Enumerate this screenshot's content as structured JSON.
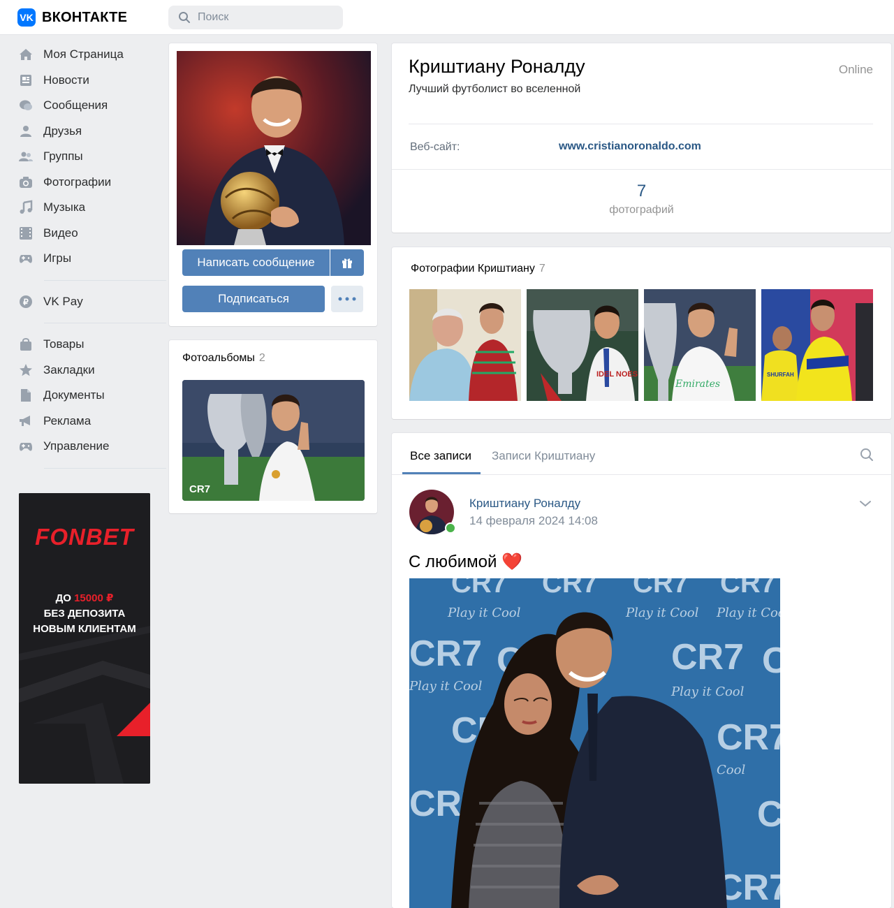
{
  "header": {
    "brand": "ВКОНТАКТЕ",
    "search_placeholder": "Поиск"
  },
  "sidebar": {
    "items": [
      {
        "label": "Моя Страница",
        "icon": "home-icon"
      },
      {
        "label": "Новости",
        "icon": "news-icon"
      },
      {
        "label": "Сообщения",
        "icon": "messages-icon"
      },
      {
        "label": "Друзья",
        "icon": "friends-icon"
      },
      {
        "label": "Группы",
        "icon": "groups-icon"
      },
      {
        "label": "Фотографии",
        "icon": "camera-icon"
      },
      {
        "label": "Музыка",
        "icon": "music-icon"
      },
      {
        "label": "Видео",
        "icon": "video-icon"
      },
      {
        "label": "Игры",
        "icon": "gamepad-icon"
      },
      {
        "label": "VK Pay",
        "icon": "vkpay-icon"
      },
      {
        "label": "Товары",
        "icon": "bag-icon"
      },
      {
        "label": "Закладки",
        "icon": "star-icon"
      },
      {
        "label": "Документы",
        "icon": "document-icon"
      },
      {
        "label": "Реклама",
        "icon": "megaphone-icon"
      },
      {
        "label": "Управление",
        "icon": "gamepad-icon"
      }
    ]
  },
  "ad": {
    "logo": "FONBET",
    "line1_prefix": "ДО ",
    "line1_amount": "15000 ₽",
    "line2": "БЕЗ ДЕПОЗИТА",
    "line3": "НОВЫМ КЛИЕНТАМ",
    "accent_color": "#e8202a"
  },
  "profile": {
    "name": "Криштиану Роналду",
    "status": "Лучший футболист во вселенной",
    "online": "Online",
    "website_label": "Веб-сайт:",
    "website_value": "www.cristianoronaldo.com",
    "photos_count": "7",
    "photos_label": "фотографий"
  },
  "actions": {
    "message": "Написать сообщение",
    "subscribe": "Подписаться"
  },
  "albums": {
    "title": "Фотоальбомы",
    "count": "2",
    "album_caption": "CR7"
  },
  "photos": {
    "title": "Фотографии Криштиану",
    "count": "7"
  },
  "wall": {
    "tab_all": "Все записи",
    "tab_own": "Записи Криштиану",
    "post": {
      "author": "Криштиану Роналду",
      "date": "14 февраля 2024 14:08",
      "text": "С любимой ❤️"
    }
  },
  "colors": {
    "accent": "#5181b8",
    "link": "#2a5885",
    "background": "#edeef0",
    "vk_blue": "#0077ff"
  }
}
